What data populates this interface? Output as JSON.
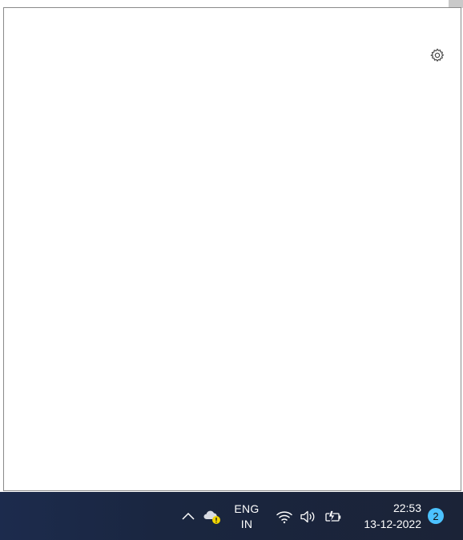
{
  "window": {
    "settings_icon": "gear-icon"
  },
  "taskbar": {
    "show_hidden_icons": "chevron-up-icon",
    "onedrive_icon": "cloud-warning-icon",
    "language": {
      "line1": "ENG",
      "line2": "IN"
    },
    "wifi_icon": "wifi-icon",
    "volume_icon": "speaker-icon",
    "battery_icon": "battery-charging-icon",
    "clock": {
      "time": "22:53",
      "date": "13-12-2022"
    },
    "notification_count": "2"
  },
  "colors": {
    "taskbar_bg": "#1b2440",
    "notification_badge": "#4cc2ff",
    "warning": "#f2d600"
  }
}
